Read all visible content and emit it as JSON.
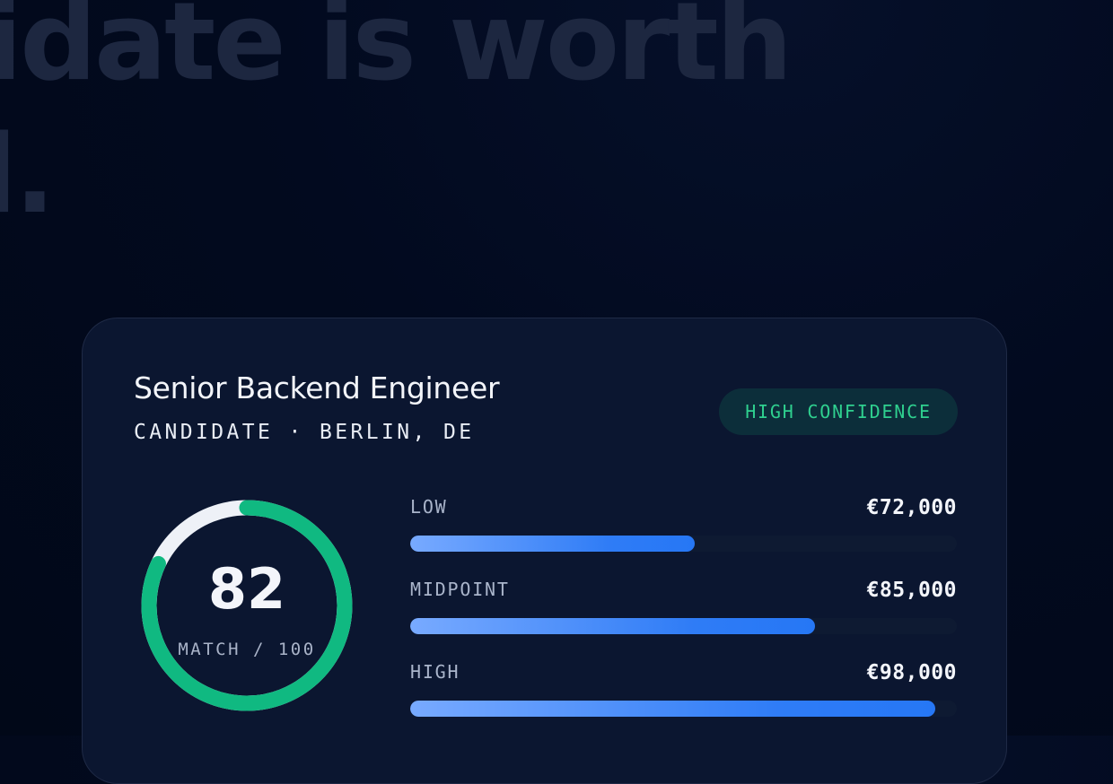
{
  "headline": {
    "line1": "idate is worth",
    "line2": "l."
  },
  "card": {
    "title": "Senior Backend Engineer",
    "subtitle": "CANDIDATE · BERLIN, DE",
    "badge": "HIGH CONFIDENCE",
    "match": {
      "score": "82",
      "caption": "MATCH / 100",
      "value": 82,
      "max": 100
    },
    "ranges": [
      {
        "label": "LOW",
        "amount": "€72,000",
        "fill": 0.52
      },
      {
        "label": "MIDPOINT",
        "amount": "€85,000",
        "fill": 0.74
      },
      {
        "label": "HIGH",
        "amount": "€98,000",
        "fill": 0.96
      }
    ]
  },
  "colors": {
    "accent_green": "#10b981",
    "gauge_track": "#eef1f7",
    "badge_text": "#2fd08f",
    "bar_blue": "#2f7cf6"
  }
}
